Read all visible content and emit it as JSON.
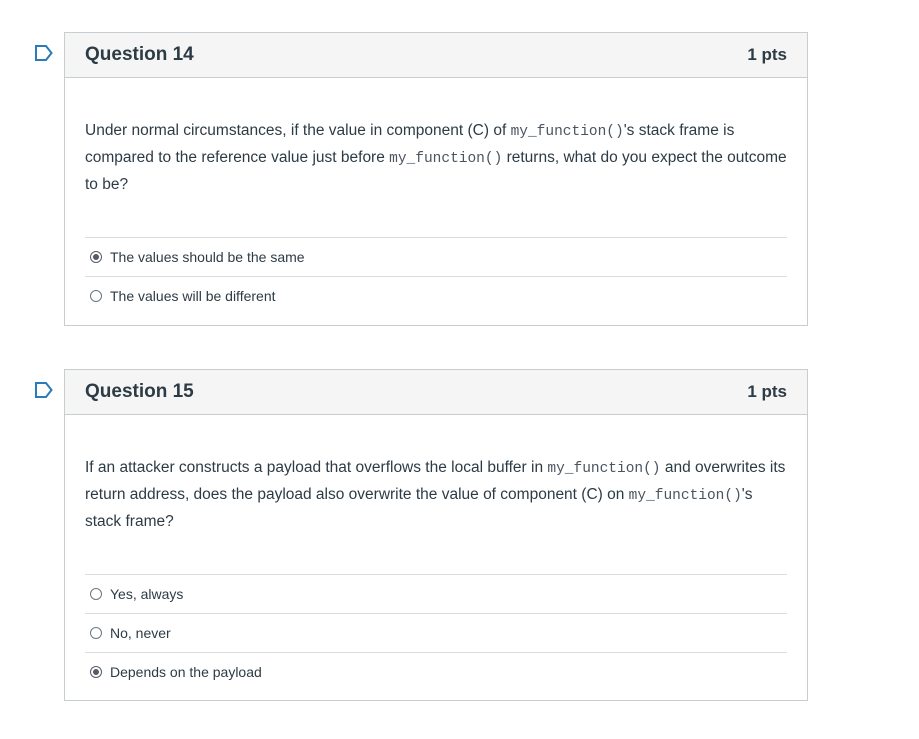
{
  "questions": [
    {
      "title": "Question 14",
      "points": "1 pts",
      "text_parts": [
        "Under normal circumstances, if the value in component (C) of ",
        "my_function()",
        "'s stack frame is compared to the reference value just before ",
        "my_function()",
        " returns, what do you expect the outcome to be?"
      ],
      "answers": [
        {
          "label": "The values should be the same",
          "selected": true
        },
        {
          "label": "The values will be different",
          "selected": false
        }
      ]
    },
    {
      "title": "Question 15",
      "points": "1 pts",
      "text_parts": [
        "If an attacker constructs a payload that overflows the local buffer in ",
        "my_function()",
        " and overwrites its return address, does the payload also overwrite the value of component (C) on ",
        "my_function()",
        "'s stack frame?"
      ],
      "answers": [
        {
          "label": "Yes, always",
          "selected": false
        },
        {
          "label": "No, never",
          "selected": false
        },
        {
          "label": "Depends on the payload",
          "selected": true
        }
      ]
    }
  ],
  "colors": {
    "flag": "#2d7ab8",
    "border": "#c7cdd1",
    "header_bg": "#f5f5f5"
  },
  "icons": {
    "flag": "flag-bookmark-icon"
  }
}
